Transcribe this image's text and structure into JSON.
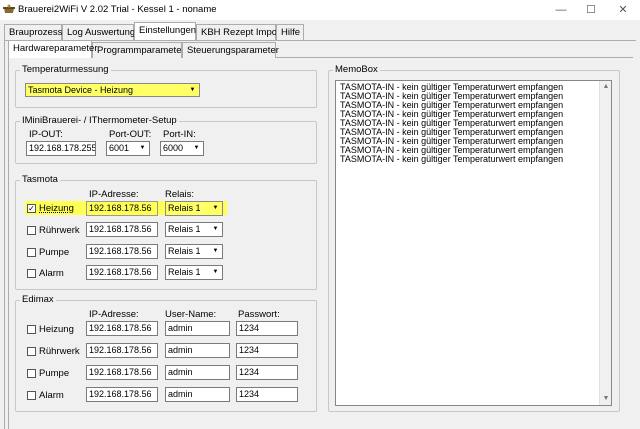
{
  "window": {
    "title": "Brauerei2WiFi V 2.02 Trial - Kessel 1 - noname",
    "minimize_glyph": "—",
    "maximize_glyph": "☐",
    "close_glyph": "✕"
  },
  "main_tabs": [
    "Brauprozess",
    "Log Auswertung",
    "Einstellungen",
    "KBH Rezept Import",
    "Hilfe"
  ],
  "sub_tabs": [
    "Hardwareparameter",
    "Programmparameter",
    "Steuerungsparameter"
  ],
  "temperatur": {
    "group_label": "Temperaturmessung",
    "selected": "Tasmota Device - Heizung"
  },
  "iminibrauerei": {
    "group_label": "IMiniBrauerei- / IThermometer-Setup",
    "ip_out_label": "IP-OUT:",
    "port_out_label": "Port-OUT:",
    "port_in_label": "Port-IN:",
    "ip_out": "192.168.178.255",
    "port_out": "6001",
    "port_in": "6000"
  },
  "tasmota": {
    "group_label": "Tasmota",
    "ip_header": "IP-Adresse:",
    "relais_header": "Relais:",
    "rows": [
      {
        "label": "Heizung",
        "checked": "✓",
        "ip": "192.168.178.56",
        "relais": "Relais 1"
      },
      {
        "label": "Rührwerk",
        "checked": "",
        "ip": "192.168.178.56",
        "relais": "Relais 1"
      },
      {
        "label": "Pumpe",
        "checked": "",
        "ip": "192.168.178.56",
        "relais": "Relais 1"
      },
      {
        "label": "Alarm",
        "checked": "",
        "ip": "192.168.178.56",
        "relais": "Relais 1"
      }
    ]
  },
  "edimax": {
    "group_label": "Edimax",
    "ip_header": "IP-Adresse:",
    "user_header": "User-Name:",
    "pass_header": "Passwort:",
    "rows": [
      {
        "label": "Heizung",
        "ip": "192.168.178.56",
        "user": "admin",
        "pass": "1234"
      },
      {
        "label": "Rührwerk",
        "ip": "192.168.178.56",
        "user": "admin",
        "pass": "1234"
      },
      {
        "label": "Pumpe",
        "ip": "192.168.178.56",
        "user": "admin",
        "pass": "1234"
      },
      {
        "label": "Alarm",
        "ip": "192.168.178.56",
        "user": "admin",
        "pass": "1234"
      }
    ]
  },
  "memobox": {
    "group_label": "MemoBox",
    "lines": [
      "TASMOTA-IN - kein gültiger Temperaturwert empfangen",
      "TASMOTA-IN - kein gültiger Temperaturwert empfangen",
      "TASMOTA-IN - kein gültiger Temperaturwert empfangen",
      "TASMOTA-IN - kein gültiger Temperaturwert empfangen",
      "TASMOTA-IN - kein gültiger Temperaturwert empfangen",
      "TASMOTA-IN - kein gültiger Temperaturwert empfangen",
      "TASMOTA-IN - kein gültiger Temperaturwert empfangen",
      "TASMOTA-IN - kein gültiger Temperaturwert empfangen",
      "TASMOTA-IN - kein gültiger Temperaturwert empfangen"
    ]
  },
  "colors": {
    "highlight": "#ffff55",
    "window_bg": "#f0f0f0"
  }
}
